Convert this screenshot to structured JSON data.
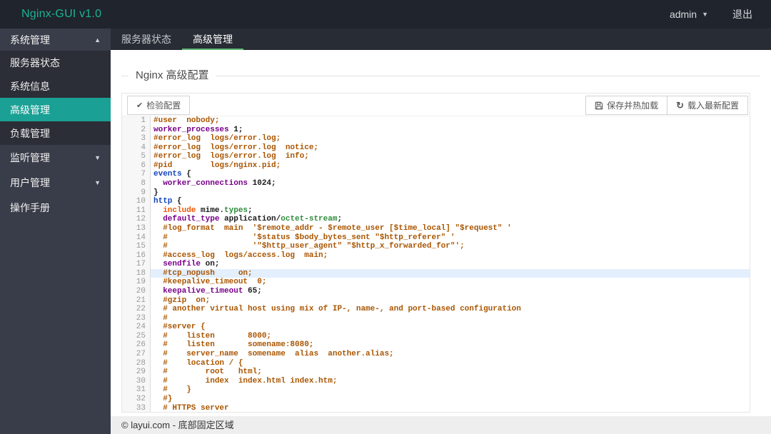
{
  "app": {
    "logo": "Nginx-GUI v1.0",
    "user": "admin",
    "logout_label": "退出"
  },
  "colors": {
    "accent_green": "#1ab394",
    "tab_underline": "#5FB878",
    "sidebar_active": "#1aa094",
    "header_bg": "#20242c",
    "sidebar_bg": "#393D49",
    "activeline_bg": "#e3effd",
    "comment": "#aa5500",
    "keyword": "#770088",
    "block": "#1144bb",
    "important": "#ee5500",
    "type": "#2e8b3a"
  },
  "sidebar": {
    "items": [
      {
        "name": "system-management",
        "label": "系统管理",
        "type": "group-open",
        "arrow": "up"
      },
      {
        "name": "server-status",
        "label": "服务器状态",
        "type": "child",
        "active": false
      },
      {
        "name": "system-info",
        "label": "系统信息",
        "type": "child",
        "active": false
      },
      {
        "name": "advanced-management",
        "label": "高级管理",
        "type": "child",
        "active": true
      },
      {
        "name": "load-management",
        "label": "负载管理",
        "type": "child",
        "active": false
      },
      {
        "name": "listen-management",
        "label": "监听管理",
        "type": "group-collapsed",
        "arrow": "down"
      },
      {
        "name": "user-management",
        "label": "用户管理",
        "type": "group-collapsed",
        "arrow": "down"
      },
      {
        "name": "operation-manual",
        "label": "操作手册",
        "type": "item"
      }
    ]
  },
  "tabs": [
    {
      "name": "server-status",
      "label": "服务器状态",
      "active": false
    },
    {
      "name": "advanced-management",
      "label": "高级管理",
      "active": true
    }
  ],
  "page": {
    "section_title": "Nginx 高级配置"
  },
  "toolbar": {
    "check_label": "检验配置",
    "save_label": "保存并热加载",
    "reload_label": "载入最新配置",
    "check_icon": "✔",
    "refresh_icon": "↻"
  },
  "editor": {
    "active_line": 18,
    "lines": [
      [
        [
          "c",
          "#user  nobody;"
        ]
      ],
      [
        [
          "k",
          "worker_processes"
        ],
        [
          "t",
          " 1;"
        ]
      ],
      [
        [
          "c",
          "#error_log  logs/error.log;"
        ]
      ],
      [
        [
          "c",
          "#error_log  logs/error.log  notice;"
        ]
      ],
      [
        [
          "c",
          "#error_log  logs/error.log  info;"
        ]
      ],
      [
        [
          "c",
          "#pid        logs/nginx.pid;"
        ]
      ],
      [
        [
          "b",
          "events"
        ],
        [
          "t",
          " {"
        ]
      ],
      [
        [
          "t",
          "  "
        ],
        [
          "k",
          "worker_connections"
        ],
        [
          "t",
          " 1024;"
        ]
      ],
      [
        [
          "t",
          "}"
        ]
      ],
      [
        [
          "b",
          "http"
        ],
        [
          "t",
          " {"
        ]
      ],
      [
        [
          "t",
          "  "
        ],
        [
          "i",
          "include"
        ],
        [
          "t",
          " mime."
        ],
        [
          "g",
          "types"
        ],
        [
          "t",
          ";"
        ]
      ],
      [
        [
          "t",
          "  "
        ],
        [
          "k",
          "default_type"
        ],
        [
          "t",
          " application/"
        ],
        [
          "g",
          "octet-stream"
        ],
        [
          "t",
          ";"
        ]
      ],
      [
        [
          "t",
          "  "
        ],
        [
          "c",
          "#log_format  main  '$remote_addr - $remote_user [$time_local] \"$request\" '"
        ]
      ],
      [
        [
          "t",
          "  "
        ],
        [
          "c",
          "#                  '$status $body_bytes_sent \"$http_referer\" '"
        ]
      ],
      [
        [
          "t",
          "  "
        ],
        [
          "c",
          "#                  '\"$http_user_agent\" \"$http_x_forwarded_for\"';"
        ]
      ],
      [
        [
          "t",
          "  "
        ],
        [
          "c",
          "#access_log  logs/access.log  main;"
        ]
      ],
      [
        [
          "t",
          "  "
        ],
        [
          "k",
          "sendfile"
        ],
        [
          "t",
          " on;"
        ]
      ],
      [
        [
          "t",
          "  "
        ],
        [
          "c",
          "#tcp_nopush     on;"
        ]
      ],
      [
        [
          "t",
          "  "
        ],
        [
          "c",
          "#keepalive_timeout  0;"
        ]
      ],
      [
        [
          "t",
          "  "
        ],
        [
          "k",
          "keepalive_timeout"
        ],
        [
          "t",
          " 65;"
        ]
      ],
      [
        [
          "t",
          "  "
        ],
        [
          "c",
          "#gzip  on;"
        ]
      ],
      [
        [
          "t",
          "  "
        ],
        [
          "c",
          "# another virtual host using mix of IP-, name-, and port-based configuration"
        ]
      ],
      [
        [
          "t",
          "  "
        ],
        [
          "c",
          "#"
        ]
      ],
      [
        [
          "t",
          "  "
        ],
        [
          "c",
          "#server {"
        ]
      ],
      [
        [
          "t",
          "  "
        ],
        [
          "c",
          "#    listen       8000;"
        ]
      ],
      [
        [
          "t",
          "  "
        ],
        [
          "c",
          "#    listen       somename:8080;"
        ]
      ],
      [
        [
          "t",
          "  "
        ],
        [
          "c",
          "#    server_name  somename  alias  another.alias;"
        ]
      ],
      [
        [
          "t",
          "  "
        ],
        [
          "c",
          "#    location / {"
        ]
      ],
      [
        [
          "t",
          "  "
        ],
        [
          "c",
          "#        root   html;"
        ]
      ],
      [
        [
          "t",
          "  "
        ],
        [
          "c",
          "#        index  index.html index.htm;"
        ]
      ],
      [
        [
          "t",
          "  "
        ],
        [
          "c",
          "#    }"
        ]
      ],
      [
        [
          "t",
          "  "
        ],
        [
          "c",
          "#}"
        ]
      ],
      [
        [
          "t",
          "  "
        ],
        [
          "c",
          "# HTTPS server"
        ]
      ]
    ]
  },
  "footer": {
    "text": "© layui.com - 底部固定区域"
  }
}
